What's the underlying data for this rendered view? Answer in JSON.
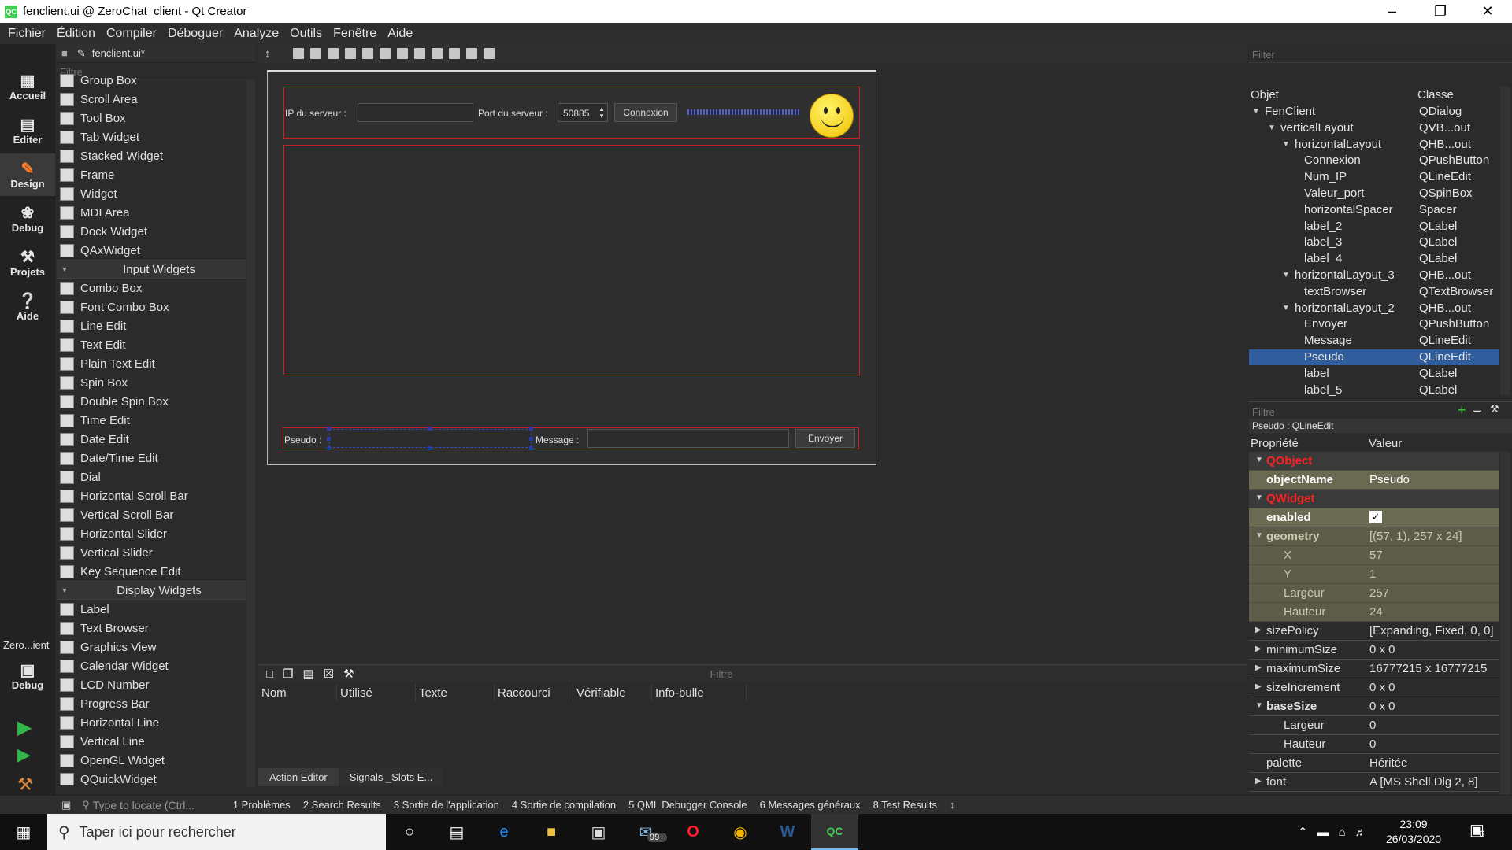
{
  "window": {
    "title": "fenclient.ui @ ZeroChat_client - Qt Creator",
    "app_icon_label": "QC"
  },
  "menu": [
    "Fichier",
    "Édition",
    "Compiler",
    "Déboguer",
    "Analyze",
    "Outils",
    "Fenêtre",
    "Aide"
  ],
  "modes": [
    "Accueil",
    "Éditer",
    "Design",
    "Debug",
    "Projets",
    "Aide"
  ],
  "kit": {
    "name": "Zero...ient",
    "mode": "Debug"
  },
  "editor_file": "fenclient.ui*",
  "widgetbox": {
    "filter_placeholder": "Filtre",
    "items_containers": [
      "Group Box",
      "Scroll Area",
      "Tool Box",
      "Tab Widget",
      "Stacked Widget",
      "Frame",
      "Widget",
      "MDI Area",
      "Dock Widget",
      "QAxWidget"
    ],
    "cat_input": "Input Widgets",
    "items_input": [
      "Combo Box",
      "Font Combo Box",
      "Line Edit",
      "Text Edit",
      "Plain Text Edit",
      "Spin Box",
      "Double Spin Box",
      "Time Edit",
      "Date Edit",
      "Date/Time Edit",
      "Dial",
      "Horizontal Scroll Bar",
      "Vertical Scroll Bar",
      "Horizontal Slider",
      "Vertical Slider",
      "Key Sequence Edit"
    ],
    "cat_display": "Display Widgets",
    "items_display": [
      "Label",
      "Text Browser",
      "Graphics View",
      "Calendar Widget",
      "LCD Number",
      "Progress Bar",
      "Horizontal Line",
      "Vertical Line",
      "OpenGL Widget",
      "QQuickWidget"
    ]
  },
  "form": {
    "ip_label": "IP du serveur :",
    "port_label": "Port du serveur :",
    "port_value": "50885",
    "connect_button": "Connexion",
    "pseudo_label": "Pseudo :",
    "message_label": "Message :",
    "send_button": "Envoyer"
  },
  "action_editor": {
    "filter_placeholder": "Filtre",
    "columns": [
      "Nom",
      "Utilisé",
      "Texte",
      "Raccourci",
      "Vérifiable",
      "Info-bulle"
    ],
    "tabs": [
      "Action Editor",
      "Signals _Slots E..."
    ]
  },
  "object_inspector": {
    "filter_placeholder": "Filter",
    "col_object": "Objet",
    "col_class": "Classe",
    "rows": [
      {
        "name": "FenClient",
        "cls": "QDialog"
      },
      {
        "name": "verticalLayout",
        "cls": "QVB...out"
      },
      {
        "name": "horizontalLayout",
        "cls": "QHB...out"
      },
      {
        "name": "Connexion",
        "cls": "QPushButton"
      },
      {
        "name": "Num_IP",
        "cls": "QLineEdit"
      },
      {
        "name": "Valeur_port",
        "cls": "QSpinBox"
      },
      {
        "name": "horizontalSpacer",
        "cls": "Spacer"
      },
      {
        "name": "label_2",
        "cls": "QLabel"
      },
      {
        "name": "label_3",
        "cls": "QLabel"
      },
      {
        "name": "label_4",
        "cls": "QLabel"
      },
      {
        "name": "horizontalLayout_3",
        "cls": "QHB...out"
      },
      {
        "name": "textBrowser",
        "cls": "QTextBrowser"
      },
      {
        "name": "horizontalLayout_2",
        "cls": "QHB...out"
      },
      {
        "name": "Envoyer",
        "cls": "QPushButton"
      },
      {
        "name": "Message",
        "cls": "QLineEdit"
      },
      {
        "name": "Pseudo",
        "cls": "QLineEdit"
      },
      {
        "name": "label",
        "cls": "QLabel"
      },
      {
        "name": "label_5",
        "cls": "QLabel"
      }
    ]
  },
  "property_editor": {
    "filter_placeholder": "Filtre",
    "context": "Pseudo : QLineEdit",
    "col_property": "Propriété",
    "col_value": "Valeur",
    "rows": [
      {
        "k": "QObject",
        "v": ""
      },
      {
        "k": "objectName",
        "v": "Pseudo"
      },
      {
        "k": "QWidget",
        "v": ""
      },
      {
        "k": "enabled",
        "v": "✓"
      },
      {
        "k": "geometry",
        "v": "[(57, 1), 257 x 24]"
      },
      {
        "k": "X",
        "v": "57"
      },
      {
        "k": "Y",
        "v": "1"
      },
      {
        "k": "Largeur",
        "v": "257"
      },
      {
        "k": "Hauteur",
        "v": "24"
      },
      {
        "k": "sizePolicy",
        "v": "[Expanding, Fixed, 0, 0]"
      },
      {
        "k": "minimumSize",
        "v": "0 x 0"
      },
      {
        "k": "maximumSize",
        "v": "16777215 x 16777215"
      },
      {
        "k": "sizeIncrement",
        "v": "0 x 0"
      },
      {
        "k": "baseSize",
        "v": "0 x 0"
      },
      {
        "k": "Largeur",
        "v": "0"
      },
      {
        "k": "Hauteur",
        "v": "0"
      },
      {
        "k": "palette",
        "v": "Héritée"
      },
      {
        "k": "font",
        "v": "A  [MS Shell Dlg 2, 8]"
      }
    ]
  },
  "statusbar": {
    "locator_placeholder": "Type to locate (Ctrl...",
    "panes": [
      "1  Problèmes",
      "2  Search Results",
      "3  Sortie de l'application",
      "4  Sortie de compilation",
      "5  QML Debugger Console",
      "6  Messages généraux",
      "8  Test Results"
    ]
  },
  "taskbar": {
    "search_placeholder": "Taper ici pour rechercher",
    "mail_badge": "99+",
    "time": "23:09",
    "date": "26/03/2020",
    "notif_count": "6"
  }
}
